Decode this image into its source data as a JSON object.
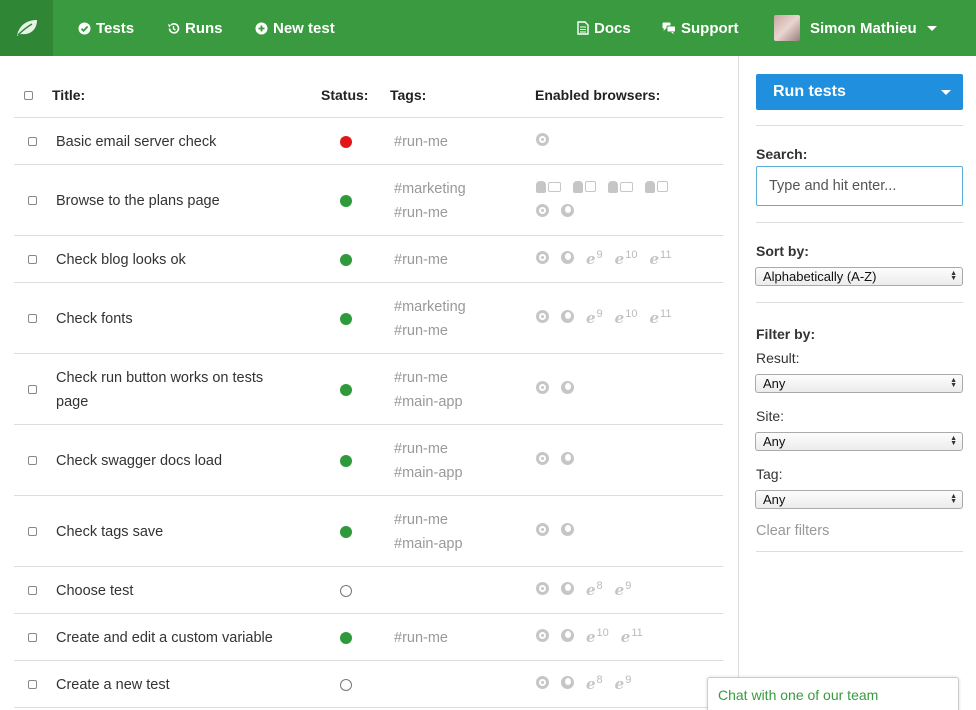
{
  "nav": {
    "logo_icon": "leaf-icon",
    "items": [
      {
        "icon": "check-circle-icon",
        "label": "Tests"
      },
      {
        "icon": "history-icon",
        "label": "Runs"
      },
      {
        "icon": "plus-circle-icon",
        "label": "New test"
      },
      {
        "icon": "document-icon",
        "label": "Docs"
      },
      {
        "icon": "chat-icon",
        "label": "Support"
      }
    ],
    "user_name": "Simon Mathieu",
    "brand_color": "#3a9a3f"
  },
  "table": {
    "headers": {
      "title": "Title:",
      "status": "Status:",
      "tags": "Tags:",
      "browsers": "Enabled browsers:"
    },
    "rows": [
      {
        "title_lines": [
          "Basic email server check"
        ],
        "status": "fail",
        "tags": [
          "#run-me"
        ],
        "browsers": [
          [
            "chrome"
          ]
        ]
      },
      {
        "title_lines": [
          "Browse to the plans page"
        ],
        "status": "pass",
        "tags": [
          "#marketing",
          "#run-me"
        ],
        "browsers": [
          [
            "android-tablet",
            "android-phone",
            "android-tablet",
            "android-phone"
          ],
          [
            "chrome",
            "firefox"
          ]
        ]
      },
      {
        "title_lines": [
          "Check blog looks ok"
        ],
        "status": "pass",
        "tags": [
          "#run-me"
        ],
        "browsers": [
          [
            "chrome",
            "firefox",
            "ie-9",
            "ie-10",
            "ie-11"
          ]
        ]
      },
      {
        "title_lines": [
          "Check fonts"
        ],
        "status": "pass",
        "tags": [
          "#marketing",
          "#run-me"
        ],
        "browsers": [
          [
            "chrome",
            "firefox",
            "ie-9",
            "ie-10",
            "ie-11"
          ]
        ]
      },
      {
        "title_lines": [
          "Check run button works on tests",
          "page"
        ],
        "status": "pass",
        "tags": [
          "#run-me",
          "#main-app"
        ],
        "browsers": [
          [
            "chrome",
            "firefox"
          ]
        ]
      },
      {
        "title_lines": [
          "Check swagger docs load"
        ],
        "status": "pass",
        "tags": [
          "#run-me",
          "#main-app"
        ],
        "browsers": [
          [
            "chrome",
            "firefox"
          ]
        ]
      },
      {
        "title_lines": [
          "Check tags save"
        ],
        "status": "pass",
        "tags": [
          "#run-me",
          "#main-app"
        ],
        "browsers": [
          [
            "chrome",
            "firefox"
          ]
        ]
      },
      {
        "title_lines": [
          "Choose test"
        ],
        "status": "none",
        "tags": [],
        "browsers": [
          [
            "chrome",
            "firefox",
            "ie-8",
            "ie-9"
          ]
        ]
      },
      {
        "title_lines": [
          "Create and edit a custom variable"
        ],
        "status": "pass",
        "tags": [
          "#run-me"
        ],
        "browsers": [
          [
            "chrome",
            "firefox",
            "ie-10",
            "ie-11"
          ]
        ]
      },
      {
        "title_lines": [
          "Create a new test"
        ],
        "status": "none",
        "tags": [],
        "browsers": [
          [
            "chrome",
            "firefox",
            "ie-8",
            "ie-9"
          ]
        ]
      }
    ]
  },
  "sidebar": {
    "run_button": "Run tests",
    "search_label": "Search:",
    "search_placeholder": "Type and hit enter...",
    "search_value": "",
    "sort_label": "Sort by:",
    "sort_value": "Alphabetically (A-Z)",
    "filter_label": "Filter by:",
    "filters": [
      {
        "label": "Result:",
        "value": "Any"
      },
      {
        "label": "Site:",
        "value": "Any"
      },
      {
        "label": "Tag:",
        "value": "Any"
      }
    ],
    "clear_filters": "Clear filters",
    "accent_color": "#1f8fde"
  },
  "chat": {
    "label": "Chat with one of our team"
  }
}
